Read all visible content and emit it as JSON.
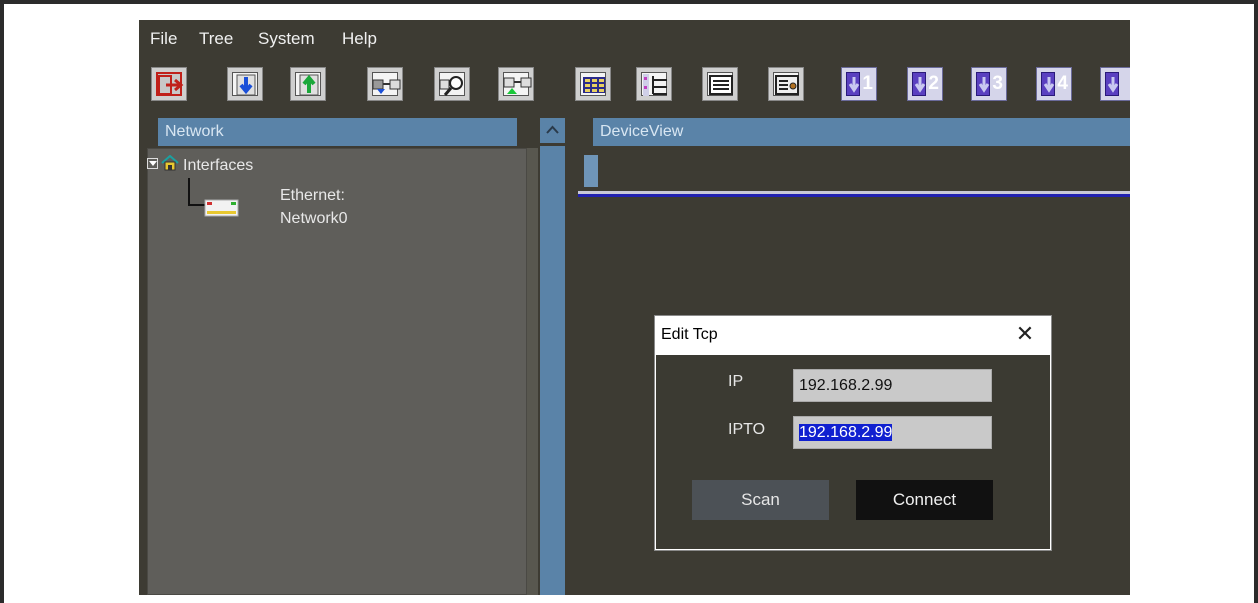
{
  "menu": {
    "items": [
      "File",
      "Tree",
      "System",
      "Help"
    ]
  },
  "toolbar": {
    "buttons": [
      "exit-icon",
      "download-icon",
      "upload-icon",
      "connect-down-icon",
      "scan-icon",
      "connect-up-icon",
      "grid-view-icon",
      "tree-view-icon",
      "list-view-icon",
      "device-config-icon"
    ],
    "numbered": [
      "1",
      "2",
      "3",
      "4"
    ]
  },
  "network": {
    "title": "Network",
    "root_label": "Interfaces",
    "child_line1": "Ethernet:",
    "child_line2": "Network0"
  },
  "device_view": {
    "title": "DeviceView"
  },
  "dialog": {
    "title": "Edit Tcp",
    "close": "✕",
    "ip_label": "IP",
    "ip_value": "192.168.2.99",
    "ipto_label": "IPTO",
    "ipto_value": "192.168.2.99",
    "scan_label": "Scan",
    "connect_label": "Connect"
  },
  "colors": {
    "background": "#3d3b33",
    "panel_header": "#5a83a8",
    "selection": "#1020d0"
  }
}
